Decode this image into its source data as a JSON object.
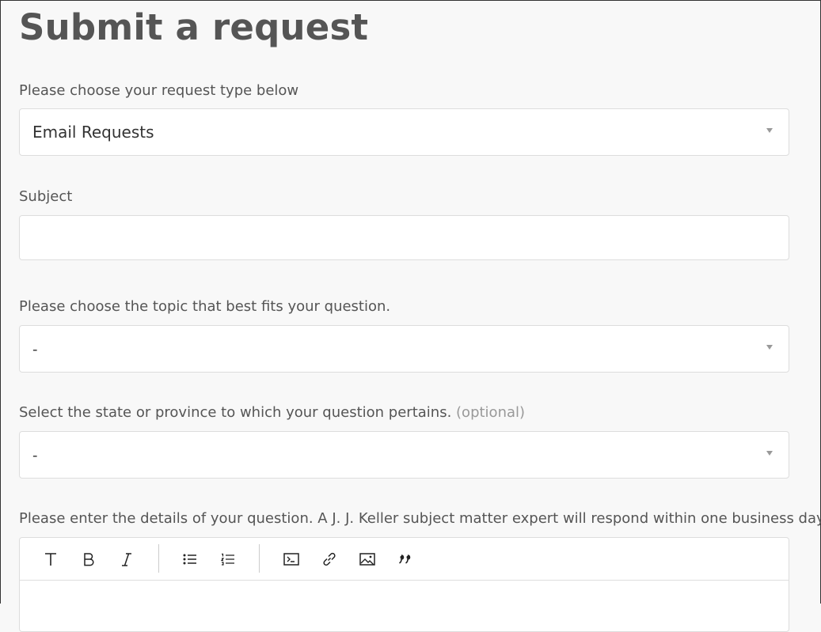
{
  "page": {
    "title": "Submit a request"
  },
  "form": {
    "request_type": {
      "label": "Please choose your request type below",
      "value": "Email Requests"
    },
    "subject": {
      "label": "Subject",
      "value": ""
    },
    "topic": {
      "label": "Please choose the topic that best fits your question.",
      "value": "-"
    },
    "state": {
      "label": "Select the state or province to which your question pertains.",
      "optional": "(optional)",
      "value": "-"
    },
    "details": {
      "label": "Please enter the details of your question. A J. J. Keller subject matter expert will respond within one business day.",
      "toolbar": [
        "text-format-icon",
        "bold-icon",
        "italic-icon",
        "bulleted-list-icon",
        "numbered-list-icon",
        "code-block-icon",
        "link-icon",
        "image-icon",
        "quote-icon"
      ]
    }
  }
}
